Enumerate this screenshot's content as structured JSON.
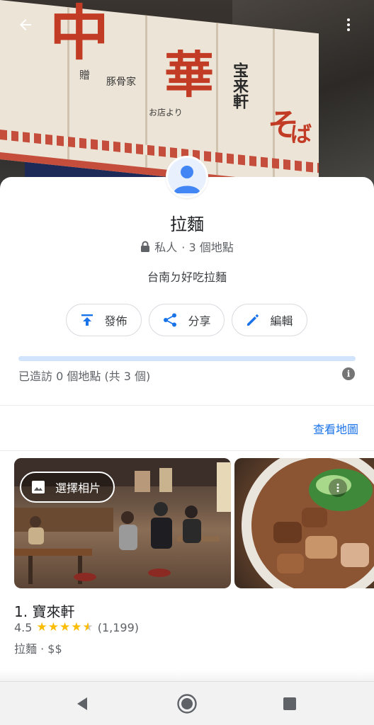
{
  "hero": {
    "noren_glyphs": [
      "中",
      "華",
      "そ",
      "ば"
    ],
    "noren_small_text": [
      "贈",
      "豚骨家",
      "宝来軒",
      "お店より"
    ]
  },
  "header": {
    "back_icon": "arrow-left-icon",
    "more_icon": "more-vert-icon"
  },
  "list": {
    "title": "拉麵",
    "privacy": "私人",
    "count": "· 3 個地點",
    "description": "台南ㄉ好吃拉麵",
    "progress": 0,
    "visited_text": "已造訪 0 個地點 (共 3 個)"
  },
  "actions": {
    "publish": "發佈",
    "share": "分享",
    "edit": "編輯"
  },
  "view_map": "查看地圖",
  "photo_actions": {
    "select_photo": "選擇相片"
  },
  "place": {
    "name": "1. 寶來軒",
    "rating": "4.5",
    "stars": 4.5,
    "reviews": "(1,199)",
    "category": "拉麵 · $$"
  },
  "colors": {
    "accent": "#1a73e8",
    "star": "#fbbc04",
    "progress_track": "#d2e3fc"
  },
  "navbar": {
    "icons": [
      "back-triangle-icon",
      "home-circle-icon",
      "recents-square-icon"
    ]
  }
}
